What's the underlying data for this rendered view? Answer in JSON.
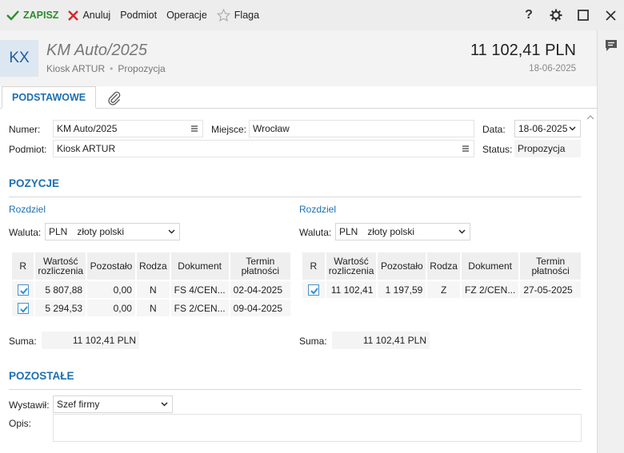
{
  "toolbar": {
    "save_label": "ZAPISZ",
    "cancel_label": "Anuluj",
    "podmiot_label": "Podmiot",
    "operacje_label": "Operacje",
    "flaga_label": "Flaga",
    "help_label": "?"
  },
  "header": {
    "badge": "KX",
    "title": "KM Auto/2025",
    "contractor": "Kiosk ARTUR",
    "status_text": "Propozycja",
    "amount": "11 102,41 PLN",
    "date": "18-06-2025"
  },
  "tabs": {
    "main": "PODSTAWOWE"
  },
  "form": {
    "numer_label": "Numer:",
    "numer_value": "KM Auto/2025",
    "miejsce_label": "Miejsce:",
    "miejsce_value": "Wrocław",
    "data_label": "Data:",
    "data_value": "18-06-2025",
    "podmiot_label": "Podmiot:",
    "podmiot_value": "Kiosk ARTUR",
    "status_label": "Status:",
    "status_value": "Propozycja"
  },
  "positions": {
    "title": "POZYCJE",
    "headers": [
      "R",
      "Wartość rozliczenia",
      "Pozostało",
      "Rodza",
      "Dokument",
      "Termin płatności"
    ],
    "left": {
      "rozdziel": "Rozdziel",
      "waluta_label": "Waluta:",
      "waluta_code": "PLN",
      "waluta_name": "złoty polski",
      "rows": [
        {
          "checked": true,
          "value": "5 807,88",
          "remaining": "0,00",
          "type": "N",
          "document": "FS 4/CEN...",
          "due": "02-04-2025"
        },
        {
          "checked": true,
          "value": "5 294,53",
          "remaining": "0,00",
          "type": "N",
          "document": "FS 2/CEN...",
          "due": "09-04-2025"
        }
      ],
      "suma_label": "Suma:",
      "suma_value": "11 102,41 PLN"
    },
    "right": {
      "rozdziel": "Rozdziel",
      "waluta_label": "Waluta:",
      "waluta_code": "PLN",
      "waluta_name": "złoty polski",
      "rows": [
        {
          "checked": true,
          "value": "11 102,41",
          "remaining": "1 197,59",
          "type": "Z",
          "document": "FZ 2/CEN...",
          "due": "27-05-2025"
        }
      ],
      "suma_label": "Suma:",
      "suma_value": "11 102,41 PLN"
    }
  },
  "other": {
    "title": "POZOSTAŁE",
    "wystawil_label": "Wystawił:",
    "wystawil_value": "Szef firmy",
    "opis_label": "Opis:",
    "opis_value": ""
  },
  "colors": {
    "accent": "#1d6fb0",
    "save": "#2e8b2e",
    "cancel": "#d9262c",
    "checkbox": "#2d8fd5"
  }
}
